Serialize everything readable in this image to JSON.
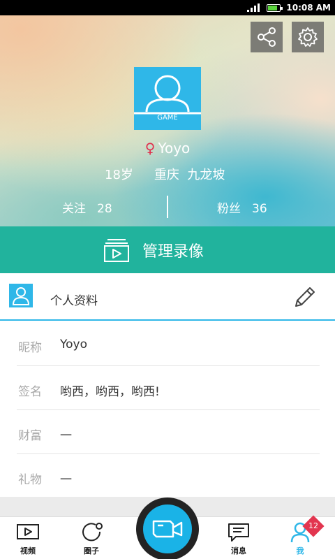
{
  "status_bar": {
    "time": "10:08 AM"
  },
  "profile": {
    "avatar_badge_text": "GAME",
    "gender_symbol": "♀",
    "name": "Yoyo",
    "age": "18岁",
    "location": "重庆  九龙坡",
    "following_label": "关注",
    "following_count": "28",
    "fans_label": "粉丝",
    "fans_count": "36"
  },
  "manage": {
    "label": "管理录像"
  },
  "section": {
    "title": "个人资料"
  },
  "fields": [
    {
      "label": "昵称",
      "value": "Yoyo"
    },
    {
      "label": "签名",
      "value": "哟西，哟西，哟西!"
    },
    {
      "label": "财富",
      "value": "一"
    },
    {
      "label": "礼物",
      "value": "一"
    }
  ],
  "nav": {
    "video": "视频",
    "circle": "圈子",
    "messages": "消息",
    "me": "我",
    "me_badge": "12"
  },
  "colors": {
    "accent_blue": "#2fb7e8",
    "accent_green": "#21b39d",
    "badge_red": "#e2354f"
  }
}
